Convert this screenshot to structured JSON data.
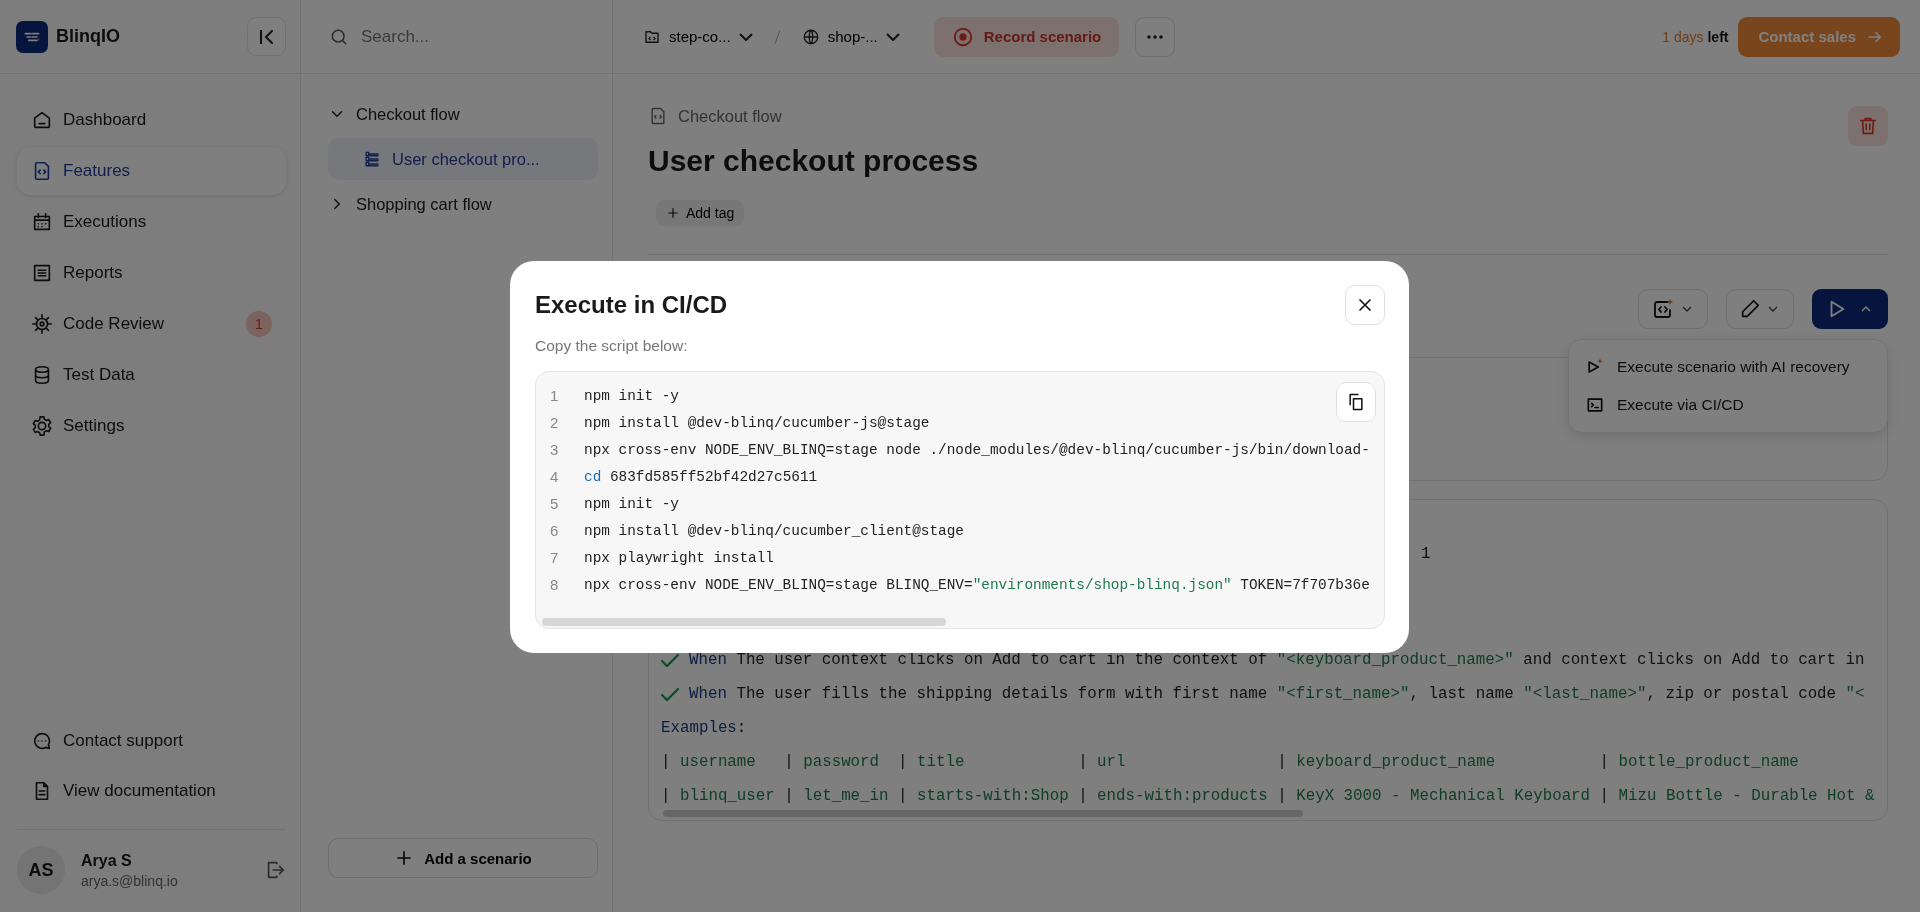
{
  "brand": {
    "name": "BlinqIO"
  },
  "nav": [
    {
      "label": "Dashboard",
      "selected": false
    },
    {
      "label": "Features",
      "selected": true
    },
    {
      "label": "Executions",
      "selected": false
    },
    {
      "label": "Reports",
      "selected": false
    },
    {
      "label": "Code Review",
      "selected": false,
      "badge": "1"
    },
    {
      "label": "Test Data",
      "selected": false
    },
    {
      "label": "Settings",
      "selected": false
    }
  ],
  "footer_links": [
    {
      "label": "Contact support"
    },
    {
      "label": "View documentation"
    }
  ],
  "user": {
    "initials": "AS",
    "name": "Arya S",
    "email": "arya.s@blinq.io"
  },
  "search": {
    "placeholder": "Search..."
  },
  "tree": [
    {
      "label": "Checkout flow",
      "expanded": true,
      "children": [
        {
          "label": "User checkout pro...",
          "selected": true
        }
      ]
    },
    {
      "label": "Shopping cart flow",
      "expanded": false
    }
  ],
  "add_scenario": "Add a scenario",
  "topbar": {
    "project": "step-co...",
    "environment": "shop-...",
    "record": "Record scenario",
    "trial_days": "1 days",
    "trial_suffix": "left",
    "contact": "Contact sales"
  },
  "feature": {
    "breadcrumb": "Checkout flow",
    "title": "User checkout process",
    "add_tag": "Add tag"
  },
  "run_menu": [
    {
      "label": "Execute scenario with AI recovery"
    },
    {
      "label": "Execute via CI/CD"
    }
  ],
  "scenario": {
    "stray": "1",
    "steps": [
      {
        "tokens": [
          {
            "text": "When",
            "kind": "keyword"
          },
          {
            "text": " The user context clicks on Add to cart in the context of ",
            "kind": "plain"
          },
          {
            "text": "\"<keyboard_product_name>\"",
            "kind": "string"
          },
          {
            "text": " and context clicks on Add to cart in",
            "kind": "plain"
          }
        ]
      },
      {
        "tokens": [
          {
            "text": "When",
            "kind": "keyword"
          },
          {
            "text": " The user fills the shipping details form with first name ",
            "kind": "plain"
          },
          {
            "text": "\"<first_name>\"",
            "kind": "string"
          },
          {
            "text": ", last name ",
            "kind": "plain"
          },
          {
            "text": "\"<last_name>\"",
            "kind": "string"
          },
          {
            "text": ", zip or postal code ",
            "kind": "plain"
          },
          {
            "text": "\"<",
            "kind": "string"
          }
        ]
      }
    ],
    "examples": [
      [
        {
          "text": "Examples",
          "kind": "keyword"
        },
        {
          "text": ":",
          "kind": "plain"
        }
      ],
      [
        {
          "text": "| ",
          "kind": "plain"
        },
        {
          "text": "username   ",
          "kind": "string"
        },
        {
          "text": "| ",
          "kind": "plain"
        },
        {
          "text": "password  ",
          "kind": "string"
        },
        {
          "text": "| ",
          "kind": "plain"
        },
        {
          "text": "title            ",
          "kind": "string"
        },
        {
          "text": "| ",
          "kind": "plain"
        },
        {
          "text": "url                ",
          "kind": "string"
        },
        {
          "text": "| ",
          "kind": "plain"
        },
        {
          "text": "keyboard_product_name           ",
          "kind": "string"
        },
        {
          "text": "| ",
          "kind": "plain"
        },
        {
          "text": "bottle_product_name",
          "kind": "string"
        }
      ],
      [
        {
          "text": "| ",
          "kind": "plain"
        },
        {
          "text": "blinq_user ",
          "kind": "string"
        },
        {
          "text": "| ",
          "kind": "plain"
        },
        {
          "text": "let_me_in ",
          "kind": "string"
        },
        {
          "text": "| ",
          "kind": "plain"
        },
        {
          "text": "starts-with:Shop ",
          "kind": "string"
        },
        {
          "text": "| ",
          "kind": "plain"
        },
        {
          "text": "ends-with:products ",
          "kind": "string"
        },
        {
          "text": "| ",
          "kind": "plain"
        },
        {
          "text": "KeyX 3000 - Mechanical Keyboard ",
          "kind": "string"
        },
        {
          "text": "| ",
          "kind": "plain"
        },
        {
          "text": "Mizu Bottle - Durable Hot &",
          "kind": "string"
        }
      ]
    ]
  },
  "modal": {
    "title": "Execute in CI/CD",
    "subtitle": "Copy the script below:",
    "lines": [
      {
        "num": "1",
        "tokens": [
          {
            "text": "npm init -y",
            "kind": "plain"
          }
        ]
      },
      {
        "num": "2",
        "tokens": [
          {
            "text": "npm install @dev-blinq/cucumber-js@stage",
            "kind": "plain"
          }
        ]
      },
      {
        "num": "3",
        "tokens": [
          {
            "text": "npx cross-env NODE_ENV_BLINQ=stage node ./node_modules/@dev-blinq/cucumber-js/bin/download-",
            "kind": "plain"
          }
        ]
      },
      {
        "num": "4",
        "tokens": [
          {
            "text": "cd",
            "kind": "builtin"
          },
          {
            "text": " 683fd585ff52bf42d27c5611",
            "kind": "plain"
          }
        ]
      },
      {
        "num": "5",
        "tokens": [
          {
            "text": "npm init -y",
            "kind": "plain"
          }
        ]
      },
      {
        "num": "6",
        "tokens": [
          {
            "text": "npm install @dev-blinq/cucumber_client@stage",
            "kind": "plain"
          }
        ]
      },
      {
        "num": "7",
        "tokens": [
          {
            "text": "npx playwright install",
            "kind": "plain"
          }
        ]
      },
      {
        "num": "8",
        "tokens": [
          {
            "text": "npx cross-env NODE_ENV_BLINQ=stage BLINQ_ENV=",
            "kind": "plain"
          },
          {
            "text": "\"environments/shop-blinq.json\"",
            "kind": "string"
          },
          {
            "text": " TOKEN=7f707b36e",
            "kind": "plain"
          }
        ]
      }
    ]
  }
}
